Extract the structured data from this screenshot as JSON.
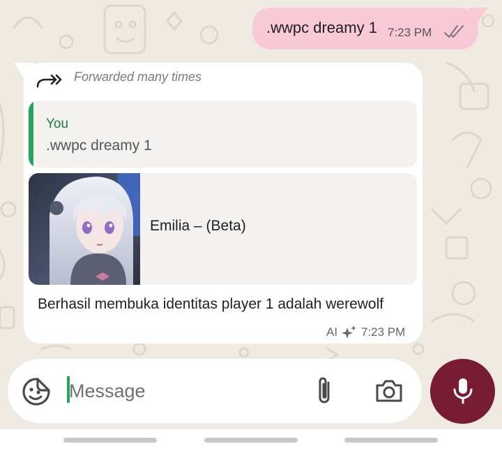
{
  "outgoing": {
    "text": ".wwpc dreamy 1",
    "time": "7:23 PM",
    "status_icon": "double-check-icon"
  },
  "incoming": {
    "forwarded_label": "Forwarded many times",
    "forwarded_icon": "forward-arrow-icon",
    "quote": {
      "author": "You",
      "text": ".wwpc dreamy 1"
    },
    "link_preview": {
      "title": "Emilia – (Beta)",
      "image": "anime-girl-thumbnail"
    },
    "text": "Berhasil membuka identitas player 1 adalah werewolf",
    "ai_label": "AI",
    "ai_icon": "sparkle-icon",
    "time": "7:23 PM"
  },
  "input_bar": {
    "placeholder": "Message",
    "value": "",
    "icons": [
      "sticker-icon",
      "paperclip-icon",
      "camera-icon",
      "mic-icon"
    ]
  },
  "colors": {
    "background": "#efeae2",
    "outgoing_bubble": "#f8c9d6",
    "incoming_bubble": "#ffffff",
    "quote_bar": "#25a55a",
    "quote_author": "#1a7a3b",
    "mic_button": "#781c34"
  }
}
